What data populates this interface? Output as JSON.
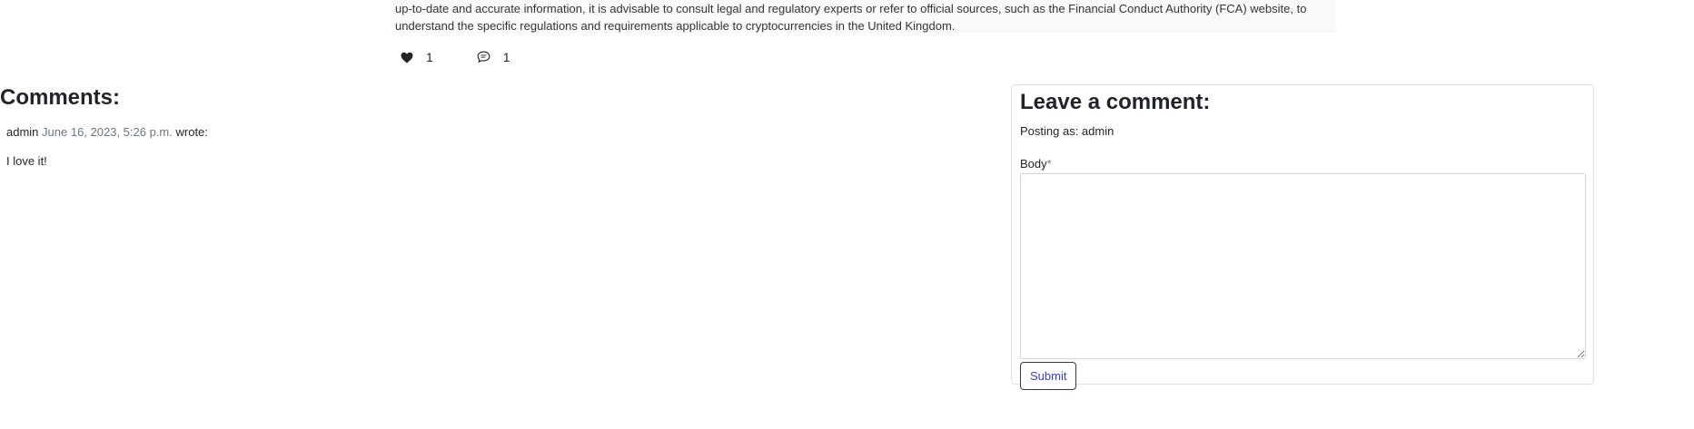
{
  "post": {
    "excerpt_line1": "up-to-date and accurate information, it is advisable to consult legal and regulatory experts or refer to official sources, such as the Financial Conduct Authority (FCA) website, to",
    "excerpt_line2": "understand the specific regulations and requirements applicable to cryptocurrencies in the United Kingdom."
  },
  "stats": {
    "likes": "1",
    "comments": "1",
    "like_icon": "heart-icon",
    "comment_icon": "speech-bubble-icon"
  },
  "comments": {
    "title": "Comments:",
    "items": [
      {
        "author": "admin",
        "date": "June 16, 2023, 5:26 p.m.",
        "wrote": "wrote:",
        "body": "I love it!"
      }
    ]
  },
  "comment_form": {
    "title": "Leave a comment:",
    "posting_as": "Posting as: admin",
    "body_label": "Body",
    "required_marker": "*",
    "body_value": "",
    "submit_label": "Submit"
  },
  "colors": {
    "accent": "#3b3bd4",
    "excerpt_bg": "#f8f9fa",
    "muted_text": "#6c757d"
  }
}
